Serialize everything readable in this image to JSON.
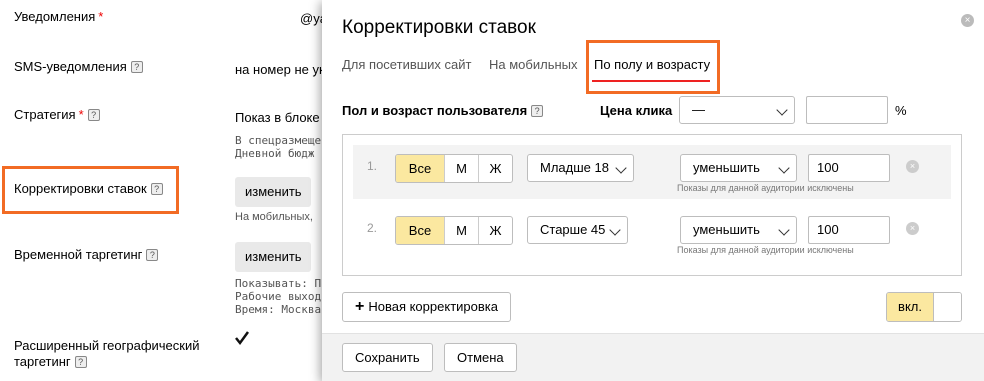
{
  "background": {
    "notifications_label": "Уведомления",
    "notifications_value": "@ya",
    "sms_label": "SMS-уведомления",
    "sms_value": "на номер не ук",
    "strategy_label": "Стратегия",
    "strategy_value": "Показ в блоке",
    "strategy_note_1": "В спецразмеще",
    "strategy_note_2": "Дневной бюдж",
    "bid_adj_label": "Корректировки ставок",
    "bid_adj_button": "изменить",
    "bid_adj_note": "На мобильных,",
    "time_target_label": "Временной таргетинг",
    "time_target_button": "изменить",
    "time_note_1": "Показывать: П",
    "time_note_2": "Рабочие выход",
    "time_note_3": "Время: Москва",
    "geo_label_1": "Расширенный географический",
    "geo_label_2": "таргетинг",
    "required_mark": "*",
    "help_glyph": "?"
  },
  "modal": {
    "title": "Корректировки ставок",
    "close_glyph": "×",
    "tabs": [
      {
        "label": "Для посетивших сайт",
        "active": false
      },
      {
        "label": "На мобильных",
        "active": false
      },
      {
        "label": "По полу и возрасту",
        "active": true
      }
    ],
    "gender_age_label": "Пол и возраст пользователя",
    "click_price_label": "Цена клика",
    "click_price_select": "—",
    "click_price_value": "",
    "percent_sign": "%",
    "rules": [
      {
        "num": "1.",
        "gender": [
          "Все",
          "М",
          "Ж"
        ],
        "gender_selected": "Все",
        "age": "Младше 18",
        "action": "уменьшить",
        "value": "100",
        "hint": "Показы для данной аудитории исключены"
      },
      {
        "num": "2.",
        "gender": [
          "Все",
          "М",
          "Ж"
        ],
        "gender_selected": "Все",
        "age": "Старше 45",
        "action": "уменьшить",
        "value": "100",
        "hint": "Показы для данной аудитории исключены"
      }
    ],
    "add_button": "Новая корректировка",
    "add_glyph": "+",
    "toggle_label": "вкл.",
    "save_button": "Сохранить",
    "cancel_button": "Отмена"
  },
  "colors": {
    "accent_orange": "#f26b24",
    "selected_yellow": "#fbe8a0",
    "tab_underline": "#ee2222"
  }
}
